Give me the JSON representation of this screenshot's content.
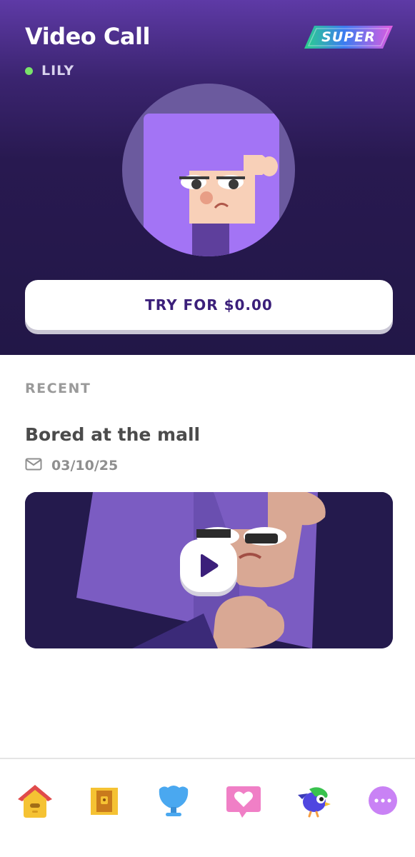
{
  "header": {
    "title": "Video Call",
    "badge": "SUPER",
    "contact_name": "LILY",
    "status_color": "#79e36a",
    "cta_label": "TRY FOR $0.00"
  },
  "recent": {
    "section_label": "RECENT",
    "calls": [
      {
        "title": "Bored at the mall",
        "date": "03/10/25",
        "icon": "envelope-icon",
        "media": "video-thumbnail"
      }
    ]
  },
  "tabbar": {
    "items": [
      {
        "name": "home",
        "icon": "birdhouse-icon"
      },
      {
        "name": "chest",
        "icon": "treasure-chest-icon"
      },
      {
        "name": "league",
        "icon": "trophy-icon"
      },
      {
        "name": "social",
        "icon": "heart-bubble-icon"
      },
      {
        "name": "character",
        "icon": "bird-character-icon"
      },
      {
        "name": "more",
        "icon": "more-icon"
      }
    ]
  },
  "colors": {
    "header_top": "#5e3aa6",
    "header_bottom": "#221747",
    "accent_purple": "#3b1f7a",
    "avatar_hair": "#a374f5"
  }
}
